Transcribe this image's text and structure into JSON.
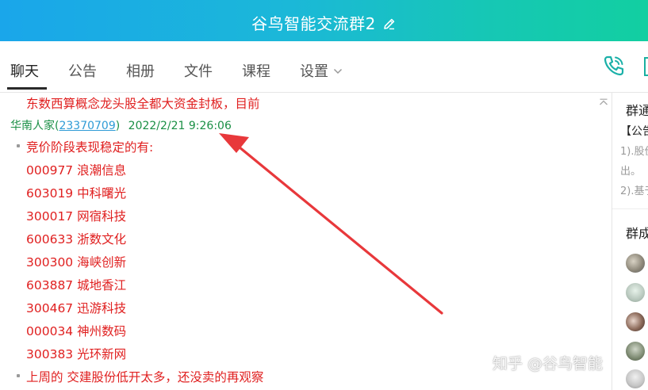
{
  "window": {
    "title": "谷鸟智能交流群2"
  },
  "tabs": [
    {
      "label": "聊天",
      "active": true
    },
    {
      "label": "公告"
    },
    {
      "label": "相册"
    },
    {
      "label": "文件"
    },
    {
      "label": "课程"
    },
    {
      "label": "设置"
    }
  ],
  "icons": {
    "edit": "edit-icon",
    "dropdown": "chevron-down-icon",
    "call": "phone-icon",
    "collapse": "collapse-icon",
    "arrow": "arrow-annotation"
  },
  "chat": {
    "previous_message_tail": "东数西算概念龙头股全都大资金封板，目前",
    "sender_name": "华南人家(",
    "sender_id": "23370709",
    "sender_close": ")",
    "timestamp": "2022/2/21 9:26:06",
    "intro": "竞价阶段表现稳定的有:",
    "stocks": [
      "000977 浪潮信息",
      "603019 中科曙光",
      "300017 网宿科技",
      "600633 浙数文化",
      "300300 海峡创新",
      "603887 城地香江",
      "300467 迅游科技",
      "000034 神州数码",
      "300383 光环新网"
    ],
    "closing": "上周的 交建股份低开太多，还没卖的再观察"
  },
  "right_panel": {
    "notice_heading": "群通",
    "notice_label": "【公告",
    "notice_line1": "1).股价",
    "notice_line2": "出。",
    "notice_line3": "2).基于",
    "members_heading": "群成"
  },
  "watermark": "知乎 @谷鸟智能",
  "colors": {
    "header_gradient_start": "#1aa6ea",
    "header_gradient_end": "#12cfa1",
    "message_text": "#e02020",
    "sender_green": "#1a8f45",
    "link_blue": "#2f9bd6",
    "annotation_red": "#e8383b"
  }
}
